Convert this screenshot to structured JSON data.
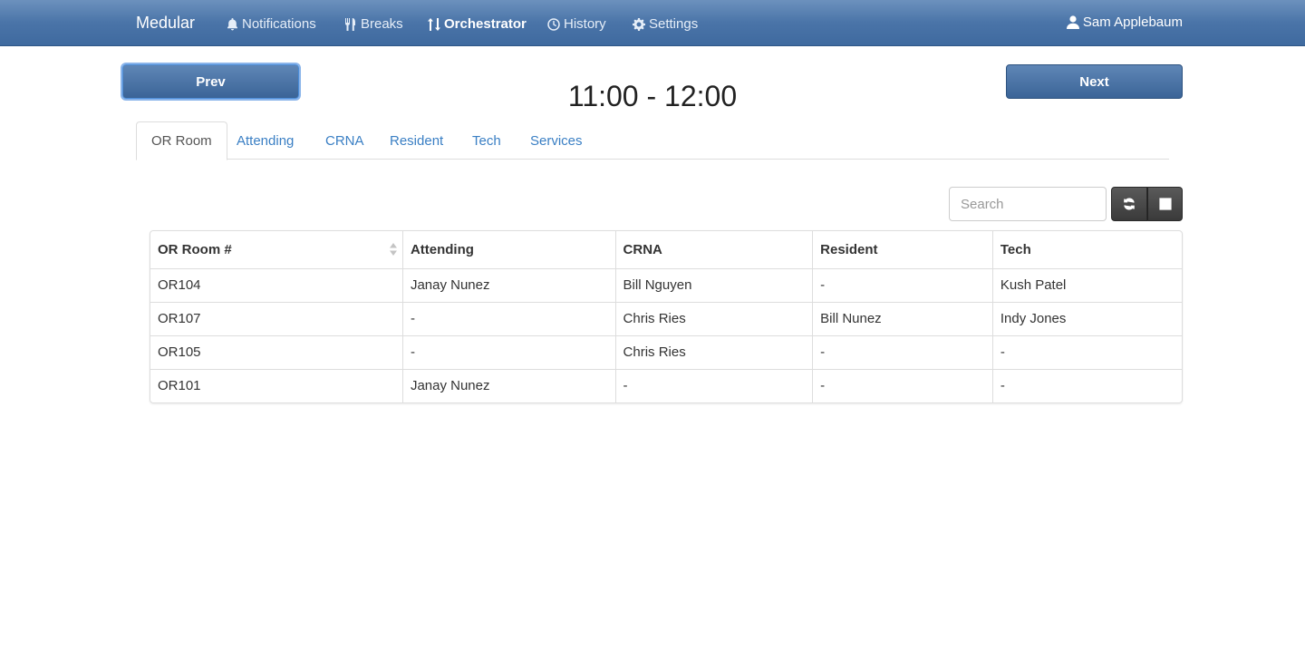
{
  "navbar": {
    "brand": "Medular",
    "links": [
      {
        "label": "Notifications",
        "icon": "bell-icon"
      },
      {
        "label": "Breaks",
        "icon": "utensils-icon"
      },
      {
        "label": "Orchestrator",
        "icon": "sort-arrows-icon",
        "active": true
      },
      {
        "label": "History",
        "icon": "clock-icon"
      },
      {
        "label": "Settings",
        "icon": "gear-icon"
      }
    ],
    "user": "Sam Applebaum",
    "colors": {
      "bar_top": "#6c91bd",
      "bar_bottom": "#3f6a9f"
    }
  },
  "controls": {
    "prev_label": "Prev",
    "next_label": "Next",
    "time_range": "11:00 - 12:00"
  },
  "tabs": [
    {
      "label": "OR Room",
      "active": true
    },
    {
      "label": "Attending"
    },
    {
      "label": "CRNA"
    },
    {
      "label": "Resident"
    },
    {
      "label": "Tech"
    },
    {
      "label": "Services"
    }
  ],
  "toolbar": {
    "search_placeholder": "Search",
    "refresh_icon": "refresh-icon",
    "columns_icon": "list-icon"
  },
  "table": {
    "headers": [
      "OR Room #",
      "Attending",
      "CRNA",
      "Resident",
      "Tech"
    ],
    "rows": [
      [
        "OR104",
        "Janay Nunez",
        "Bill Nguyen",
        "-",
        "Kush Patel"
      ],
      [
        "OR107",
        "-",
        "Chris Ries",
        "Bill Nunez",
        "Indy Jones"
      ],
      [
        "OR105",
        "-",
        "Chris Ries",
        "-",
        "-"
      ],
      [
        "OR101",
        "Janay Nunez",
        "-",
        "-",
        "-"
      ]
    ]
  },
  "colors": {
    "accent_link": "#3a7fc4",
    "button_blue": "#3b6497"
  }
}
